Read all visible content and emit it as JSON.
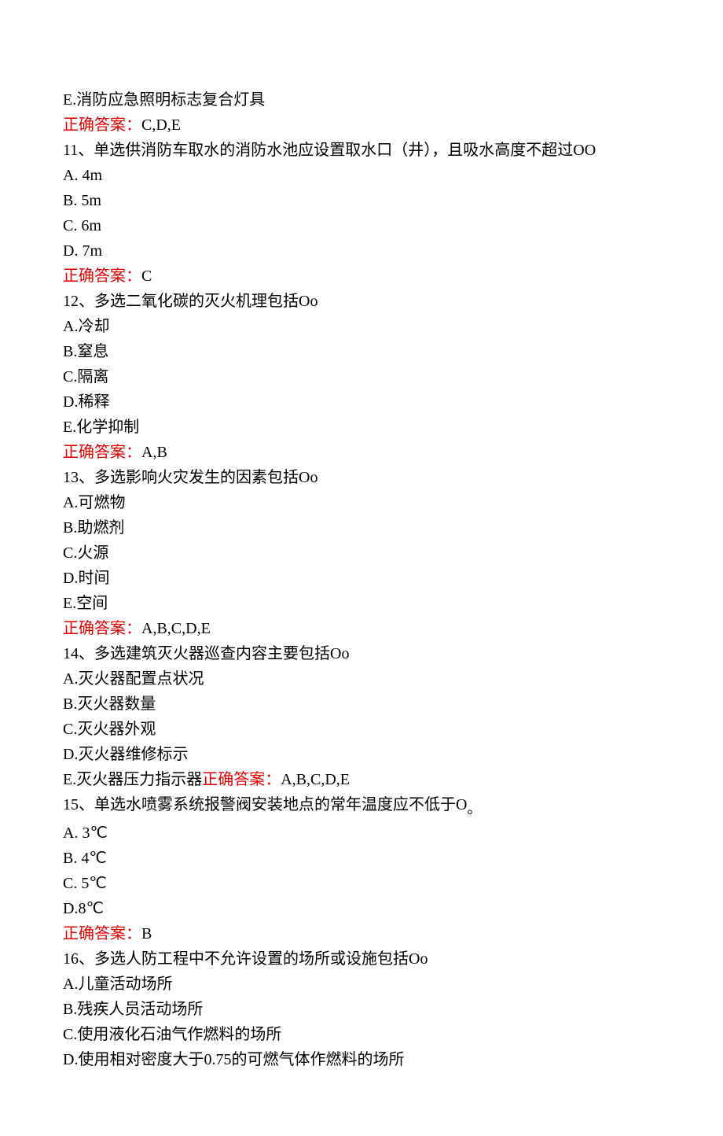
{
  "q10": {
    "optE": "E.消防应急照明标志复合灯具",
    "ansLabel": "正确答案：",
    "ansVal": "C,D,E"
  },
  "q11": {
    "stem": "11、单选供消防车取水的消防水池应设置取水口（井），且吸水高度不超过OO",
    "optA": "A. 4m",
    "optB": "B. 5m",
    "optC": "C. 6m",
    "optD": "D. 7m",
    "ansLabel": "正确答案：",
    "ansVal": "C"
  },
  "q12": {
    "stem": "12、多选二氧化碳的灭火机理包括Oo",
    "optA": "A.冷却",
    "optB": "B.窒息",
    "optC": "C.隔离",
    "optD": "D.稀释",
    "optE": "E.化学抑制",
    "ansLabel": "正确答案：",
    "ansVal": "A,B"
  },
  "q13": {
    "stem": "13、多选影响火灾发生的因素包括Oo",
    "optA": "A.可燃物",
    "optB": "B.助燃剂",
    "optC": "C.火源",
    "optD": "D.时间",
    "optE": "E.空间",
    "ansLabel": "正确答案：",
    "ansVal": "A,B,C,D,E"
  },
  "q14": {
    "stem": "14、多选建筑灭火器巡查内容主要包括Oo",
    "optA": "A.灭火器配置点状况",
    "optB": "B.灭火器数量",
    "optC": "C.灭火器外观",
    "optD": "D.灭火器维修标示",
    "optE": "E.灭火器压力指示器",
    "ansLabel": "正确答案：",
    "ansVal": "A,B,C,D,E"
  },
  "q15": {
    "stem": "15、单选水喷雾系统报警阀安装地点的常年温度应不低于O",
    "stemSuffix": "。",
    "optA": "A. 3℃",
    "optB": "B. 4℃",
    "optC": "C. 5℃",
    "optD": "D.8℃",
    "ansLabel": "正确答案：",
    "ansVal": "B"
  },
  "q16": {
    "stem": "16、多选人防工程中不允许设置的场所或设施包括Oo",
    "optA": "A.儿童活动场所",
    "optB": "B.残疾人员活动场所",
    "optC": "C.使用液化石油气作燃料的场所",
    "optD": "D.使用相对密度大于0.75的可燃气体作燃料的场所"
  }
}
